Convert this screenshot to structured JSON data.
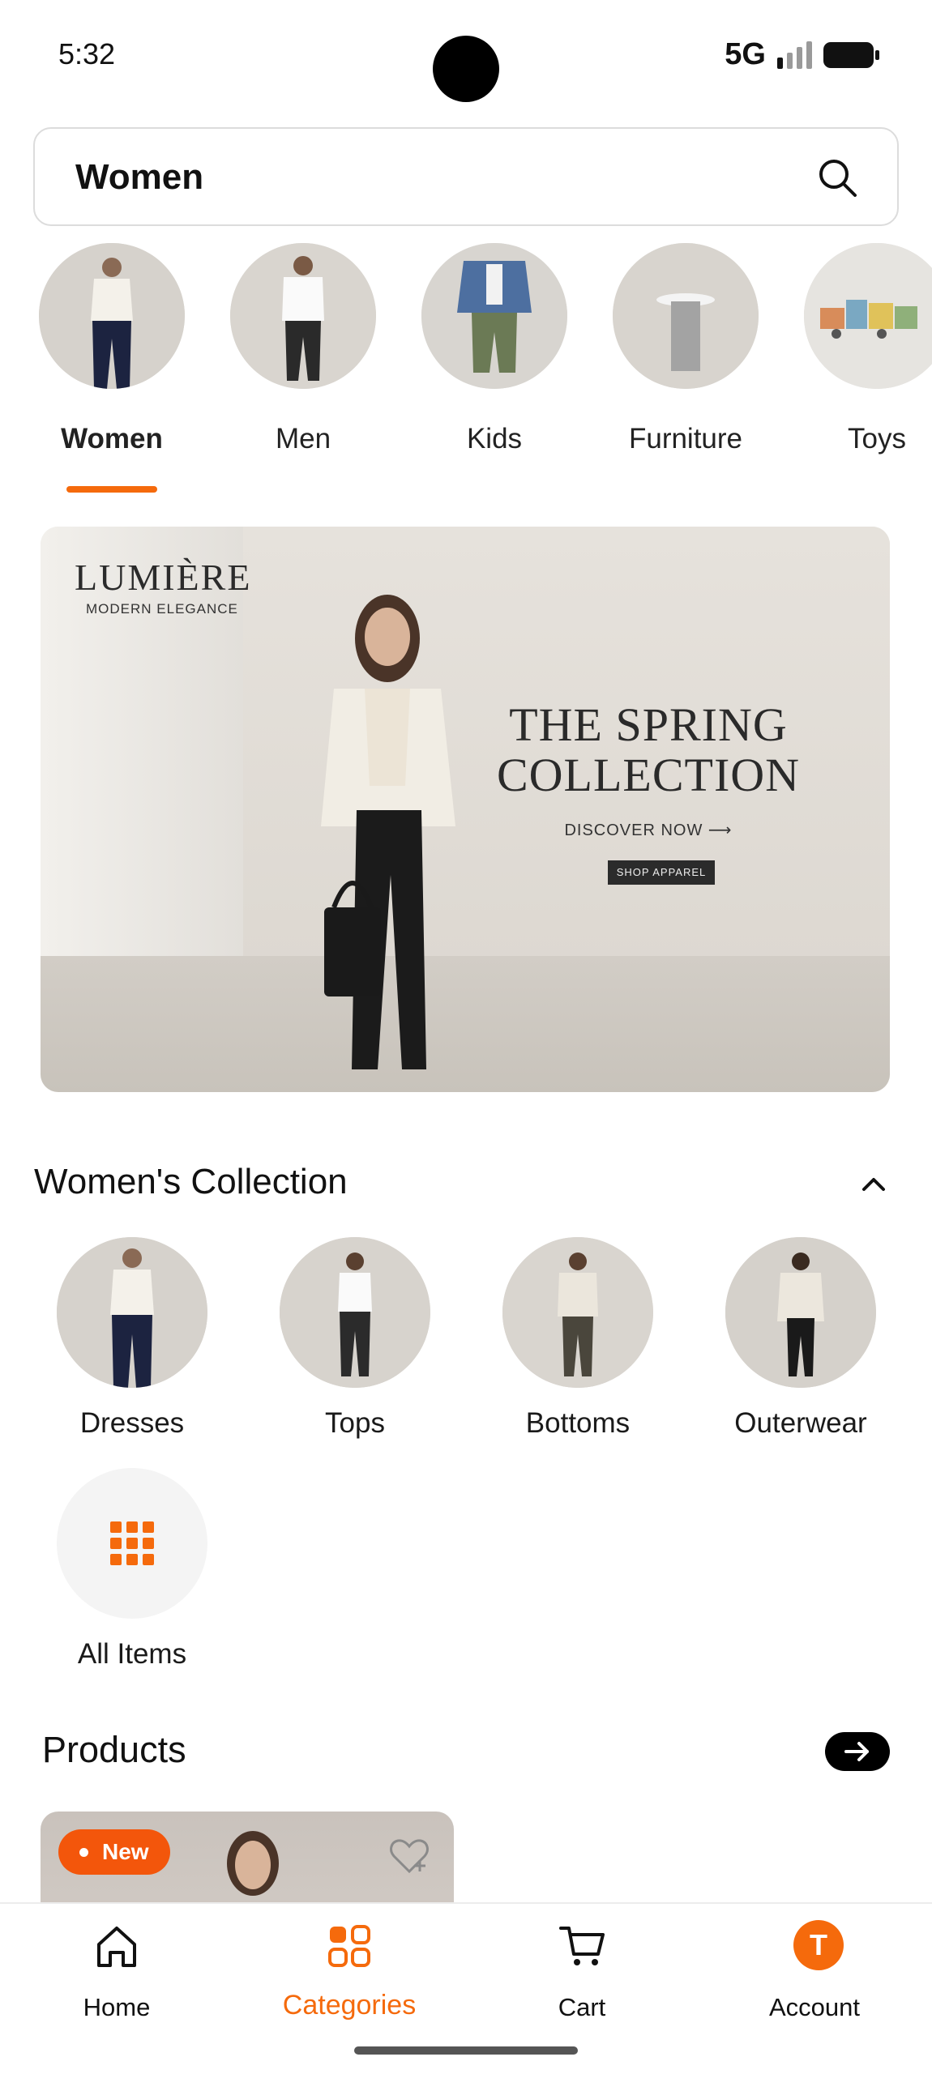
{
  "status_bar": {
    "time": "5:32",
    "network": "5G"
  },
  "search": {
    "value": "Women",
    "placeholder": ""
  },
  "categories": [
    {
      "label": "Women",
      "selected": true
    },
    {
      "label": "Men",
      "selected": false
    },
    {
      "label": "Kids",
      "selected": false
    },
    {
      "label": "Furniture",
      "selected": false
    },
    {
      "label": "Toys",
      "selected": false
    }
  ],
  "banner": {
    "brand": "LUMIÈRE",
    "tagline": "MODERN ELEGANCE",
    "title": "THE SPRING COLLECTION",
    "cta": "DISCOVER NOW ⟶",
    "button": "SHOP APPAREL"
  },
  "collection": {
    "title": "Women's Collection",
    "items": [
      {
        "label": "Dresses"
      },
      {
        "label": "Tops"
      },
      {
        "label": "Bottoms"
      },
      {
        "label": "Outerwear"
      },
      {
        "label": "All Items"
      }
    ]
  },
  "products": {
    "title": "Products",
    "card": {
      "badge": "New"
    }
  },
  "bottom_nav": [
    {
      "label": "Home",
      "icon": "home-icon",
      "active": false
    },
    {
      "label": "Categories",
      "icon": "categories-icon",
      "active": true
    },
    {
      "label": "Cart",
      "icon": "cart-icon",
      "active": false
    },
    {
      "label": "Account",
      "icon": "avatar",
      "active": false,
      "avatar_letter": "T"
    }
  ],
  "colors": {
    "accent": "#f56a0c",
    "badge": "#f3560b",
    "text": "#111111"
  }
}
